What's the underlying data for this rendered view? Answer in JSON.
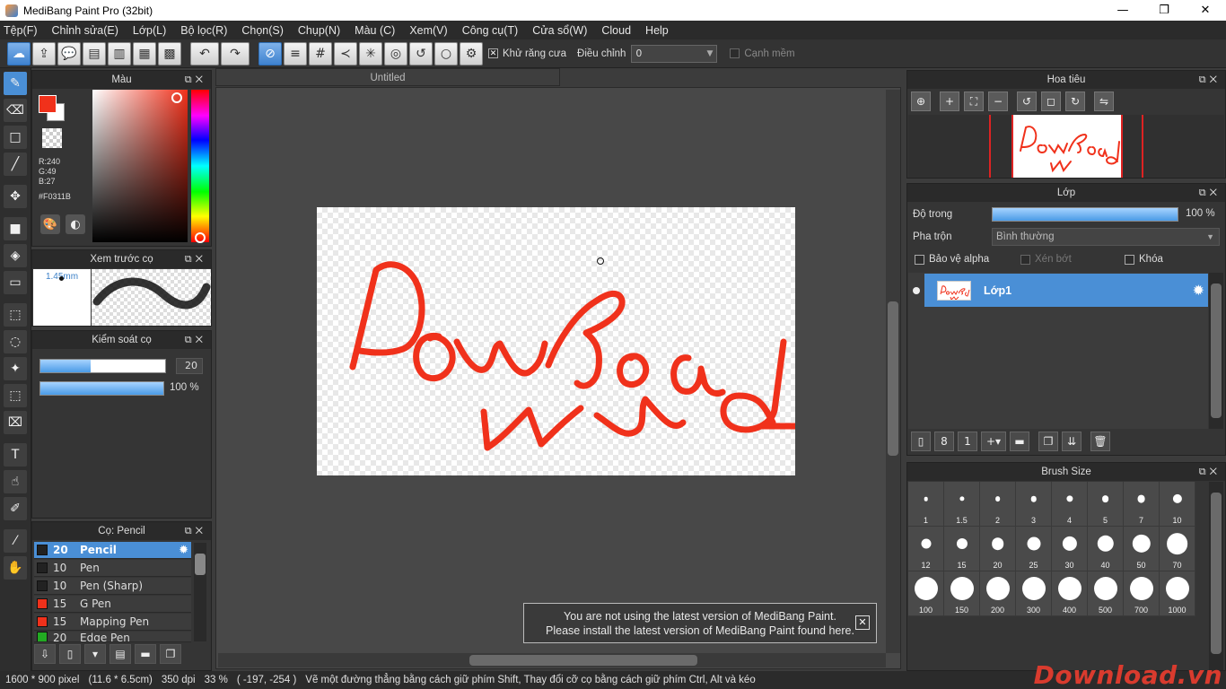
{
  "window": {
    "title": "MediBang Paint Pro (32bit)",
    "minimize": "—",
    "maximize": "❐",
    "close": "✕"
  },
  "menu": [
    "Tệp(F)",
    "Chỉnh sửa(E)",
    "Lớp(L)",
    "Bộ lọc(R)",
    "Chọn(S)",
    "Chụp(N)",
    "Màu (C)",
    "Xem(V)",
    "Công cụ(T)",
    "Cửa sổ(W)",
    "Cloud",
    "Help"
  ],
  "toolbar": {
    "antialias_label": "Khử răng cưa",
    "antialias_checked": true,
    "adjust_label": "Điều chỉnh",
    "adjust_value": "0",
    "soft_edge_label": "Cạnh mềm"
  },
  "color_panel": {
    "title": "Màu",
    "r": "R:240",
    "g": "G:49",
    "b": "B:27",
    "hex": "#F0311B",
    "fg_color": "#F0311B"
  },
  "brush_preview": {
    "title": "Xem trước cọ",
    "size": "1.45mm"
  },
  "brush_control": {
    "title": "Kiểm soát cọ",
    "size_value": "20",
    "opacity": "100 %"
  },
  "brush_list": {
    "title": "Cọ: Pencil",
    "items": [
      {
        "size": "20",
        "name": "Pencil",
        "color": "#222222"
      },
      {
        "size": "10",
        "name": "Pen",
        "color": "#222222"
      },
      {
        "size": "10",
        "name": "Pen (Sharp)",
        "color": "#222222"
      },
      {
        "size": "15",
        "name": "G Pen",
        "color": "#F0311B"
      },
      {
        "size": "15",
        "name": "Mapping Pen",
        "color": "#F0311B"
      },
      {
        "size": "20",
        "name": "Edge Pen",
        "color": "#22aa22"
      }
    ]
  },
  "document": {
    "tab": "Untitled"
  },
  "canvas_text": "Download vn",
  "notice": {
    "line1": "You are not using the latest version of MediBang Paint.",
    "line2": "Please install the latest version of MediBang Paint found here.",
    "close": "✕"
  },
  "navigator": {
    "title": "Hoa tiêu"
  },
  "layer_panel": {
    "title": "Lớp",
    "opacity_label": "Độ trong",
    "opacity_value": "100 %",
    "blend_label": "Pha trộn",
    "blend_value": "Bình thường",
    "protect_alpha": "Bảo vệ alpha",
    "clipping": "Xén bớt",
    "lock": "Khóa",
    "layer_name": "Lớp1"
  },
  "brush_size": {
    "title": "Brush Size",
    "sizes": [
      "1",
      "1.5",
      "2",
      "3",
      "4",
      "5",
      "7",
      "10",
      "12",
      "15",
      "20",
      "25",
      "30",
      "40",
      "50",
      "70",
      "100",
      "150",
      "200",
      "300",
      "400",
      "500",
      "700",
      "1000"
    ]
  },
  "status": {
    "dimensions": "1600 * 900 pixel",
    "physical": "(11.6 * 6.5cm)",
    "dpi": "350 dpi",
    "zoom": "33 %",
    "coords": "( -197, -254 )",
    "hint": "Vẽ một đường thẳng bằng cách giữ phím Shift, Thay đổi cỡ cọ bằng cách giữ phím Ctrl, Alt và kéo"
  },
  "watermark": "Download.vn"
}
